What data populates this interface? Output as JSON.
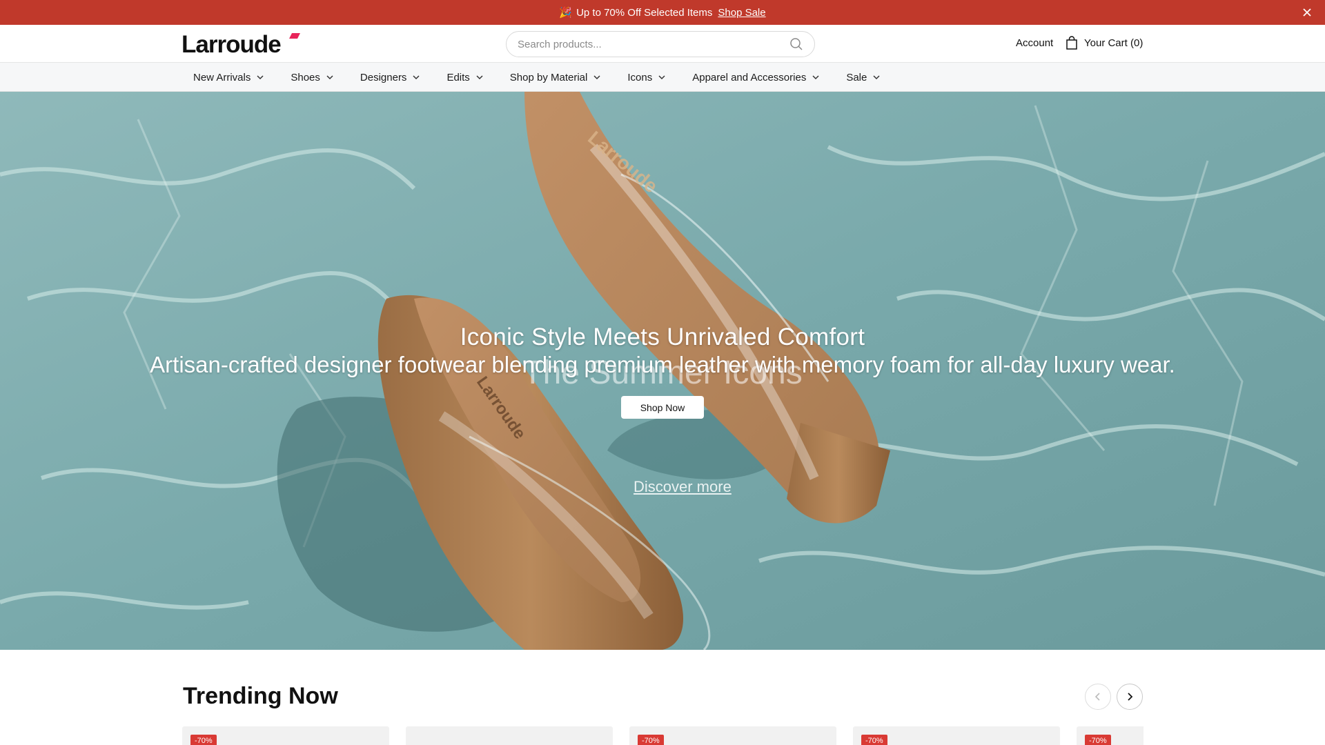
{
  "announcement": {
    "emoji": "🎉",
    "text": "Up to 70% Off Selected Items",
    "link": "Shop Sale",
    "close_icon": "close-icon"
  },
  "header": {
    "logo": "Larroude",
    "search_placeholder": "Search products...",
    "search_icon": "search-icon",
    "account": "Account",
    "cart": "Your Cart (0)",
    "cart_icon": "bag-icon"
  },
  "nav": {
    "items": [
      {
        "label": "New Arrivals"
      },
      {
        "label": "Shoes"
      },
      {
        "label": "Designers"
      },
      {
        "label": "Edits"
      },
      {
        "label": "Shop by Material"
      },
      {
        "label": "Icons"
      },
      {
        "label": "Apparel and Accessories"
      },
      {
        "label": "Sale"
      }
    ],
    "chevron_icon": "chevron-down-icon"
  },
  "hero": {
    "title": "Iconic Style Meets Unrivaled Comfort",
    "ghost_text": "The Summer Icons",
    "subtitle": "Artisan-crafted designer footwear blending premium leather with memory foam for all-day luxury wear.",
    "button": "Shop Now",
    "discover": "Discover more"
  },
  "trending": {
    "title": "Trending Now",
    "prev_icon": "chevron-left-icon",
    "next_icon": "chevron-right-icon",
    "cards": [
      {
        "badge": "-70%"
      },
      {
        "badge": ""
      },
      {
        "badge": "-70%"
      },
      {
        "badge": "-70%"
      },
      {
        "badge": "-70%"
      }
    ]
  },
  "colors": {
    "announcement_bg": "#c0392b",
    "badge": "#d93a34",
    "logo_accent": "#e8245a"
  }
}
